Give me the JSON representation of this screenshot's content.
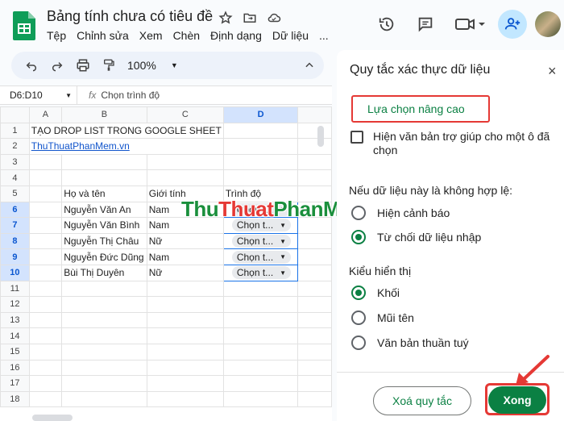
{
  "app": {
    "title": "Bảng tính chưa có tiêu đề",
    "menu": [
      "Tệp",
      "Chỉnh sửa",
      "Xem",
      "Chèn",
      "Định dạng",
      "Dữ liệu",
      "..."
    ]
  },
  "toolbar": {
    "zoom": "100%"
  },
  "formula_bar": {
    "name_box": "D6:D10",
    "fx": "fx",
    "value": "Chọn trình độ"
  },
  "sheet": {
    "columns": [
      "A",
      "B",
      "C",
      "D"
    ],
    "rows": [
      {
        "num": "1",
        "a": "TẠO DROP LIST TRONG GOOGLE SHEET",
        "b": "",
        "c": "",
        "d": ""
      },
      {
        "num": "2",
        "a": "ThuThuatPhanMem.vn",
        "b": "",
        "c": "",
        "d": ""
      },
      {
        "num": "3",
        "a": "",
        "b": "",
        "c": "",
        "d": ""
      },
      {
        "num": "4",
        "a": "",
        "b": "",
        "c": "",
        "d": ""
      },
      {
        "num": "5",
        "a": "",
        "b": "Họ và tên",
        "c": "Giới tính",
        "d": "Trình độ"
      },
      {
        "num": "6",
        "a": "",
        "b": "Nguyễn Văn An",
        "c": "Nam",
        "d": "Chọn t..."
      },
      {
        "num": "7",
        "a": "",
        "b": "Nguyễn Văn Bình",
        "c": "Nam",
        "d": "Chọn t..."
      },
      {
        "num": "8",
        "a": "",
        "b": "Nguyễn Thị Châu",
        "c": "Nữ",
        "d": "Chọn t..."
      },
      {
        "num": "9",
        "a": "",
        "b": "Nguyễn Đức Dũng",
        "c": "Nam",
        "d": "Chọn t..."
      },
      {
        "num": "10",
        "a": "",
        "b": "Bùi Thị Duyên",
        "c": "Nữ",
        "d": "Chọn t..."
      },
      {
        "num": "11",
        "a": "",
        "b": "",
        "c": "",
        "d": ""
      },
      {
        "num": "12",
        "a": "",
        "b": "",
        "c": "",
        "d": ""
      },
      {
        "num": "13",
        "a": "",
        "b": "",
        "c": "",
        "d": ""
      },
      {
        "num": "14",
        "a": "",
        "b": "",
        "c": "",
        "d": ""
      },
      {
        "num": "15",
        "a": "",
        "b": "",
        "c": "",
        "d": ""
      },
      {
        "num": "16",
        "a": "",
        "b": "",
        "c": "",
        "d": ""
      },
      {
        "num": "17",
        "a": "",
        "b": "",
        "c": "",
        "d": ""
      },
      {
        "num": "18",
        "a": "",
        "b": "",
        "c": "",
        "d": ""
      }
    ]
  },
  "watermark": "ThuThuatPhanMem.vn",
  "panel": {
    "title": "Quy tắc xác thực dữ liệu",
    "close": "×",
    "advanced_label": "Lựa chọn nâng cao",
    "help_checkbox": "Hiện văn bản trợ giúp cho một ô đã chọn",
    "invalid_label": "Nếu dữ liệu này là không hợp lệ:",
    "invalid_options": [
      {
        "label": "Hiện cảnh báo",
        "selected": false
      },
      {
        "label": "Từ chối dữ liệu nhập",
        "selected": true
      }
    ],
    "display_label": "Kiểu hiển thị",
    "display_options": [
      {
        "label": "Khối",
        "selected": true
      },
      {
        "label": "Mũi tên",
        "selected": false
      },
      {
        "label": "Văn bản thuần tuý",
        "selected": false
      }
    ],
    "remove_button": "Xoá quy tắc",
    "done_button": "Xong"
  },
  "colors": {
    "accent_green": "#0b8043",
    "highlight_red": "#e53935",
    "selection_blue": "#1a73e8"
  }
}
